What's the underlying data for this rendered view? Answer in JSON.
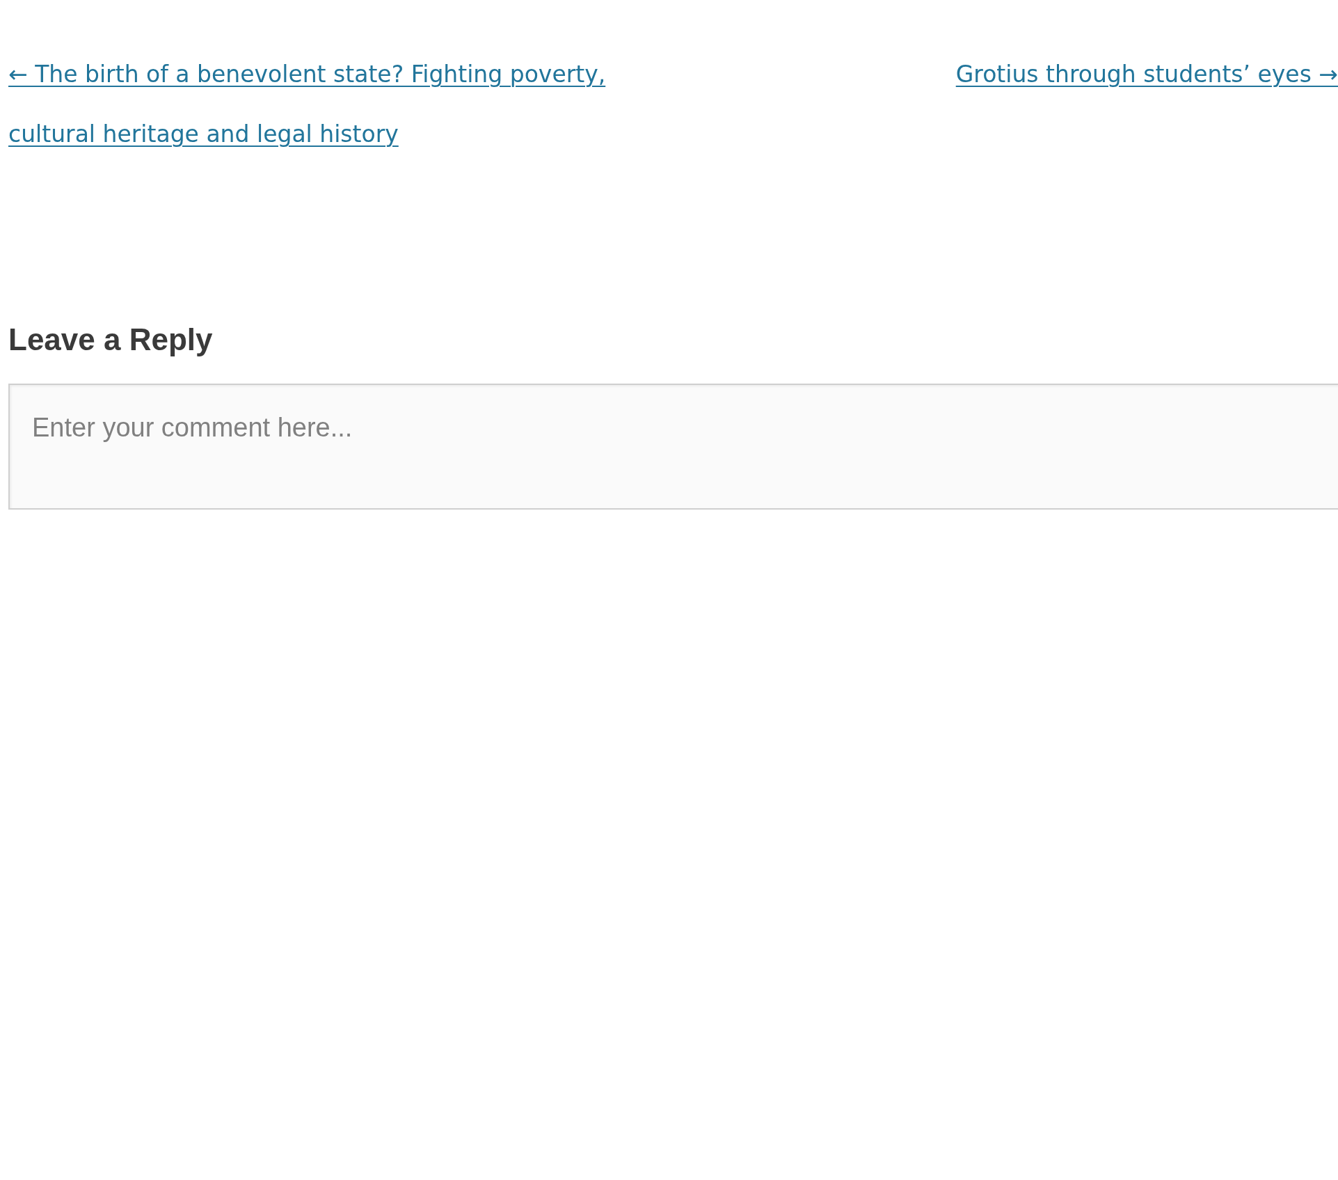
{
  "post_navigation": {
    "previous": {
      "arrow": "←",
      "title": "The birth of a benevolent state? Fighting poverty, cultural heritage and legal history"
    },
    "next": {
      "title": "Grotius through students’ eyes",
      "arrow": "→"
    }
  },
  "comments": {
    "heading": "Leave a Reply",
    "comment_field": {
      "placeholder": "Enter your comment here..."
    }
  }
}
